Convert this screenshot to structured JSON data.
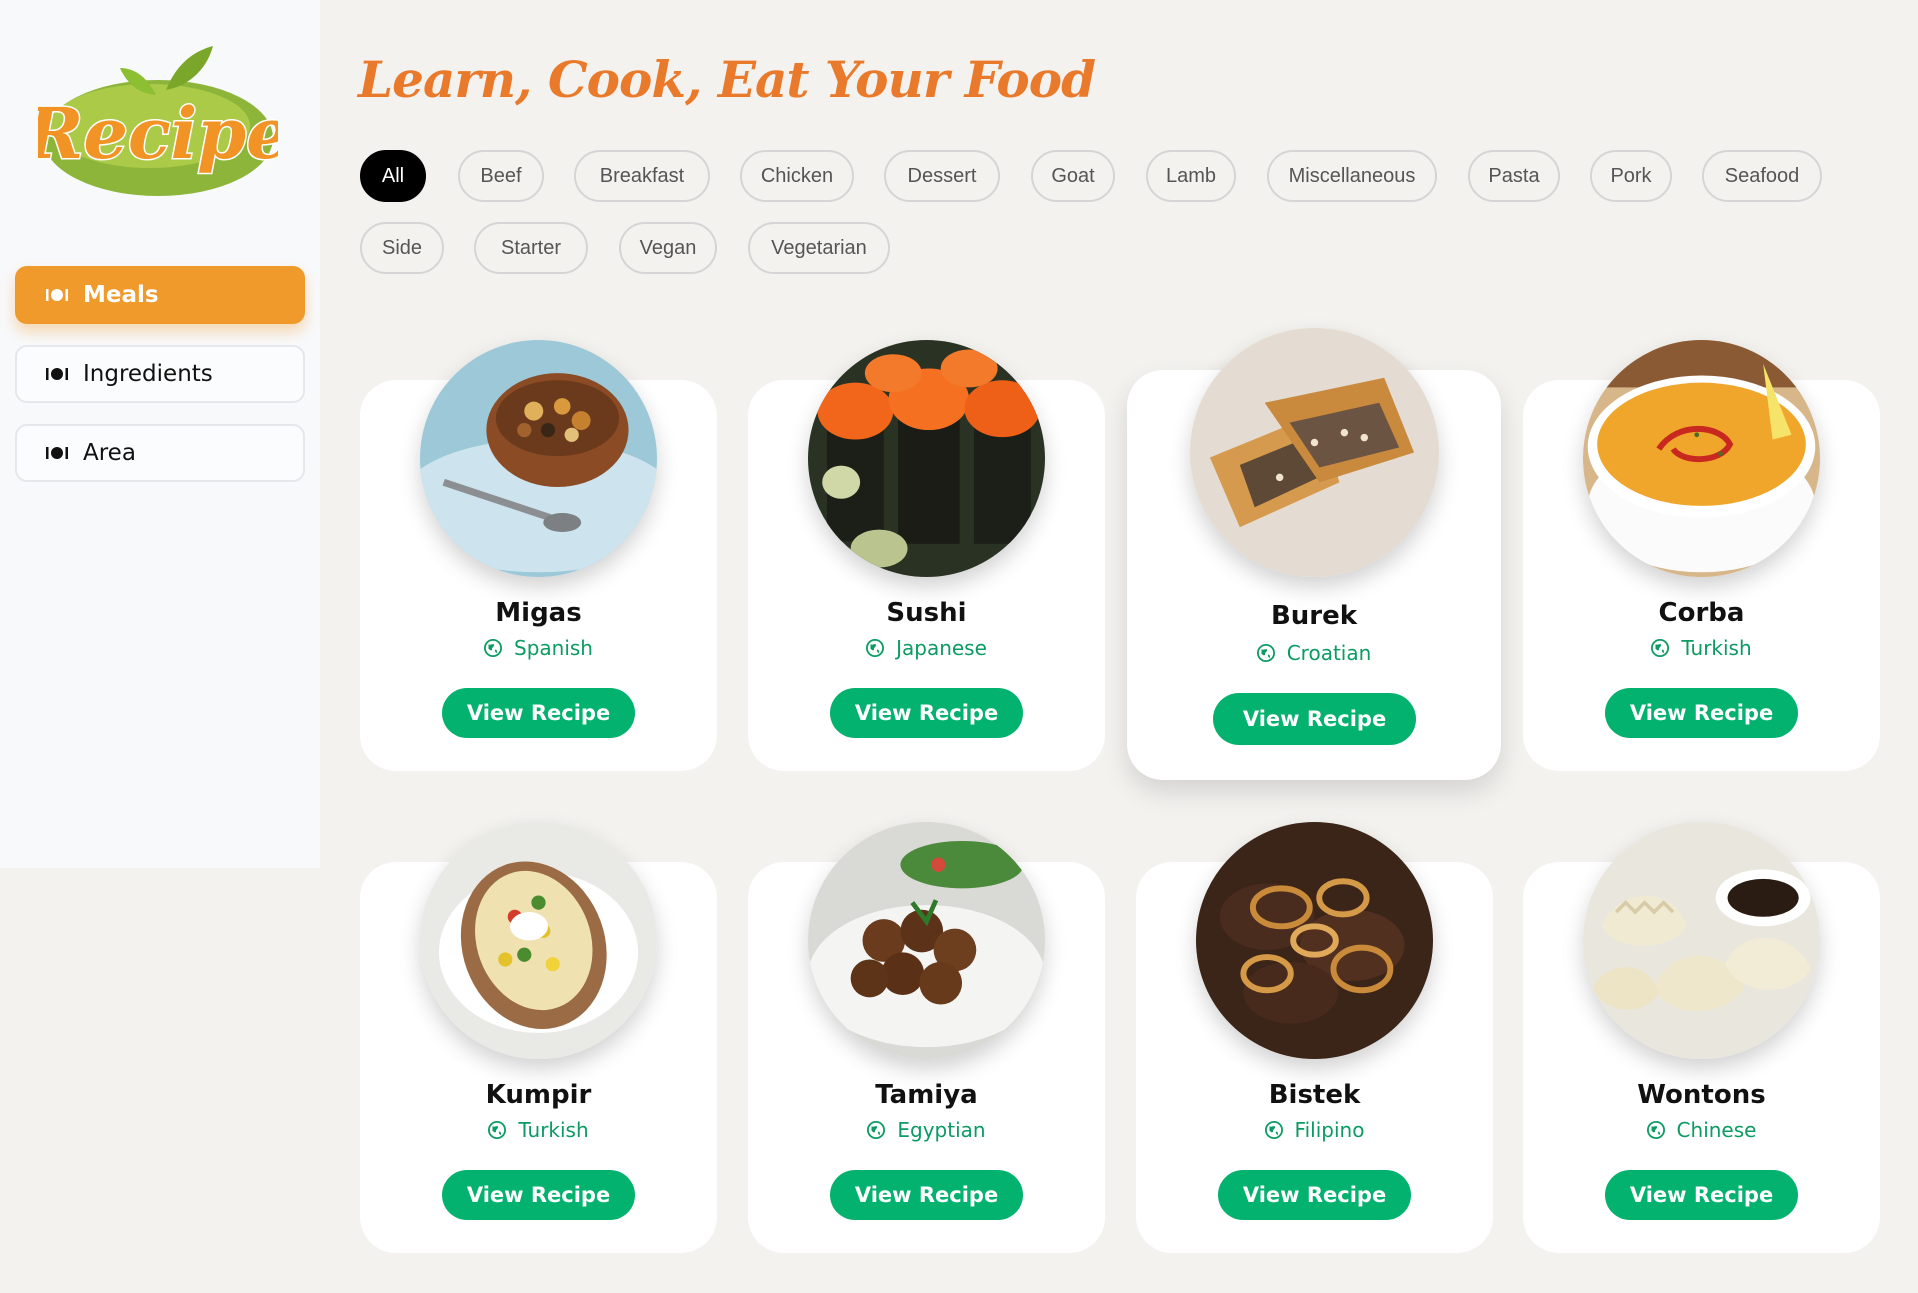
{
  "brand": {
    "logo_text": "Recipe"
  },
  "nav": {
    "items": [
      {
        "label": "Meals",
        "active": true
      },
      {
        "label": "Ingredients",
        "active": false
      },
      {
        "label": "Area",
        "active": false
      }
    ]
  },
  "page": {
    "title": "Learn, Cook, Eat Your Food"
  },
  "filters": [
    "All",
    "Beef",
    "Breakfast",
    "Chicken",
    "Dessert",
    "Goat",
    "Lamb",
    "Miscellaneous",
    "Pasta",
    "Pork",
    "Seafood",
    "Side",
    "Starter",
    "Vegan",
    "Vegetarian"
  ],
  "active_filter": "All",
  "meals": [
    {
      "name": "Migas",
      "area": "Spanish",
      "button": "View Recipe"
    },
    {
      "name": "Sushi",
      "area": "Japanese",
      "button": "View Recipe"
    },
    {
      "name": "Burek",
      "area": "Croatian",
      "button": "View Recipe"
    },
    {
      "name": "Corba",
      "area": "Turkish",
      "button": "View Recipe"
    },
    {
      "name": "Kumpir",
      "area": "Turkish",
      "button": "View Recipe"
    },
    {
      "name": "Tamiya",
      "area": "Egyptian",
      "button": "View Recipe"
    },
    {
      "name": "Bistek",
      "area": "Filipino",
      "button": "View Recipe"
    },
    {
      "name": "Wontons",
      "area": "Chinese",
      "button": "View Recipe"
    }
  ],
  "colors": {
    "accent": "#f19a2c",
    "button": "#03b26e",
    "area_text": "#0b9b63",
    "title": "#ea7a2b"
  }
}
